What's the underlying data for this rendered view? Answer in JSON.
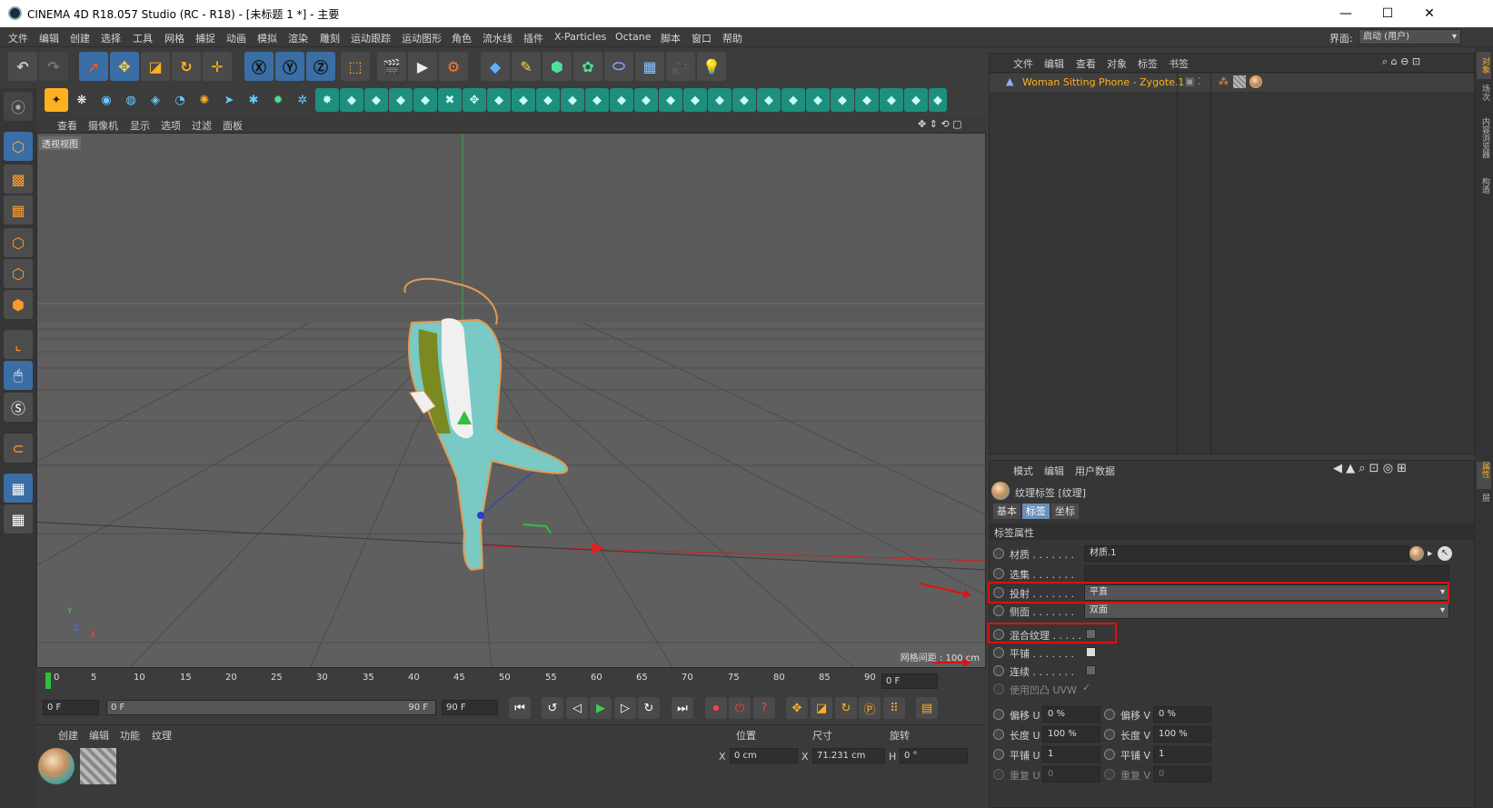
{
  "window": {
    "title": "CINEMA 4D R18.057 Studio (RC - R18) - [未标题 1 *] - 主要",
    "minimize": "—",
    "maximize": "☐",
    "close": "✕"
  },
  "menu": [
    "文件",
    "编辑",
    "创建",
    "选择",
    "工具",
    "网格",
    "捕捉",
    "动画",
    "模拟",
    "渲染",
    "雕刻",
    "运动跟踪",
    "运动图形",
    "角色",
    "流水线",
    "插件",
    "X-Particles",
    "Octane",
    "脚本",
    "窗口",
    "帮助"
  ],
  "layout": {
    "label": "界面:",
    "value": "启动 (用户)"
  },
  "viewport": {
    "menu": [
      "查看",
      "摄像机",
      "显示",
      "选项",
      "过滤",
      "面板"
    ],
    "label": "透视视图",
    "grid_spacing": "网格间距 : 100 cm",
    "axis_y": "Y",
    "axis_z": "Z",
    "axis_x": "X"
  },
  "timeline": {
    "ticks": [
      "0",
      "5",
      "10",
      "15",
      "20",
      "25",
      "30",
      "35",
      "40",
      "45",
      "50",
      "55",
      "60",
      "65",
      "70",
      "75",
      "80",
      "85",
      "90"
    ],
    "current_frame": "0 F",
    "start": "0 F",
    "range_start": "0 F",
    "range_end": "90 F",
    "end": "90 F"
  },
  "material_manager": {
    "menu": [
      "创建",
      "编辑",
      "功能",
      "纹理"
    ]
  },
  "coordinates": {
    "headers": [
      "位置",
      "尺寸",
      "旋转"
    ],
    "x_label": "X",
    "x_pos": "0 cm",
    "size_label": "X",
    "x_size": "71.231 cm",
    "rot_label": "H",
    "h_rot": "0 °"
  },
  "object_manager": {
    "menu": [
      "文件",
      "编辑",
      "查看",
      "对象",
      "标签",
      "书签"
    ],
    "object_name": "Woman Sitting Phone - Zygote.1"
  },
  "attribute_manager": {
    "menu": [
      "模式",
      "编辑",
      "用户数据"
    ],
    "title": "纹理标签 [纹理]",
    "tabs": [
      "基本",
      "标签",
      "坐标"
    ],
    "section": "标签属性",
    "material_label": "材质 . . . . . . .",
    "material_value": "材质.1",
    "selection_label": "选集 . . . . . . .",
    "projection_label": "投射 . . . . . . .",
    "projection_value": "平直",
    "side_label": "侧面 . . . . . . .",
    "side_value": "双面",
    "mix_label": "混合纹理 . . . . .",
    "tile_label": "平铺 . . . . . . .",
    "seamless_label": "连续 . . . . . . .",
    "uvw_label": "使用凹凸 UVW",
    "offset_u_label": "偏移 U",
    "offset_u": "0 %",
    "offset_v_label": "偏移 V",
    "offset_v": "0 %",
    "length_u_label": "长度 U",
    "length_u": "100 %",
    "length_v_label": "长度 V",
    "length_v": "100 %",
    "tiles_u_label": "平铺 U",
    "tiles_u": "1",
    "tiles_v_label": "平铺 V",
    "tiles_v": "1",
    "repeat_u_label": "重复 U",
    "repeat_u": "0",
    "repeat_v_label": "重复 V",
    "repeat_v": "0"
  },
  "right_tabs": [
    "对象",
    "场次",
    "内容浏览器",
    "构造",
    "属性",
    "层"
  ]
}
